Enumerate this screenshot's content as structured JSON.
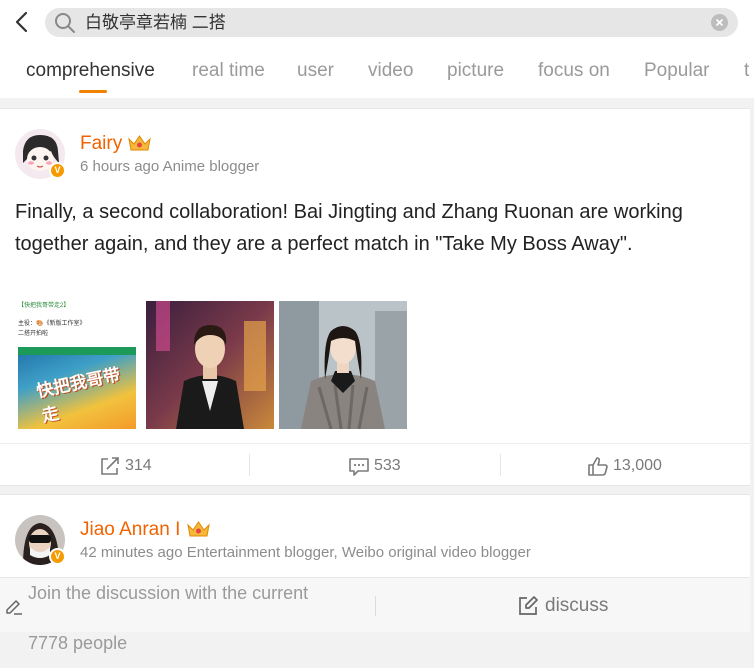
{
  "search": {
    "query": "白敬亭章若楠 二搭"
  },
  "tabs": [
    {
      "label": "comprehensive",
      "active": true
    },
    {
      "label": "real time"
    },
    {
      "label": "user"
    },
    {
      "label": "video"
    },
    {
      "label": "picture"
    },
    {
      "label": "focus on"
    },
    {
      "label": "Popular"
    },
    {
      "label": "t"
    }
  ],
  "posts": [
    {
      "author": "Fairy",
      "meta": "6 hours ago Anime blogger",
      "text": "Finally, a second collaboration! Bai Jingting and Zhang Ruonan are working together again, and they are a perfect match in \"Take My Boss Away\".",
      "images": [
        {
          "type": "poster",
          "lines": [
            "【快把我哥带走2】",
            "主役：🎨《新版工作室》",
            "二搭开拍啦"
          ],
          "title": "快把我哥带走"
        },
        {
          "type": "photo",
          "subject": "man-in-suit"
        },
        {
          "type": "photo",
          "subject": "woman-in-coat"
        }
      ],
      "actions": {
        "repost": "314",
        "comment": "533",
        "like": "13,000"
      }
    },
    {
      "author": "Jiao Anran I",
      "meta": "42 minutes ago Entertainment blogger, Weibo original video blogger"
    }
  ],
  "bottom": {
    "placeholder_line1": "Join the discussion with the current",
    "placeholder_line2": "7778 people",
    "discuss_label": "discuss"
  },
  "colors": {
    "accent": "#f08200",
    "author": "#f06300",
    "verified": "#f59b00"
  },
  "icons": [
    "back-arrow-icon",
    "search-icon",
    "clear-icon",
    "crown-icon",
    "verified-icon",
    "repost-icon",
    "comment-icon",
    "like-icon",
    "pen-icon",
    "edit-icon"
  ]
}
